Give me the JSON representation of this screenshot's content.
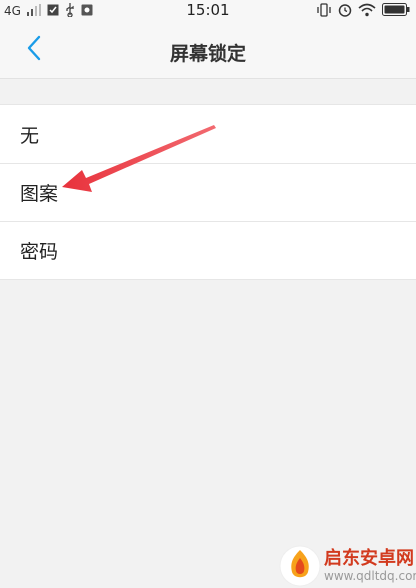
{
  "status_bar": {
    "network": "4G",
    "time": "15:01"
  },
  "header": {
    "title": "屏幕锁定"
  },
  "lock_options": [
    {
      "label": "无"
    },
    {
      "label": "图案"
    },
    {
      "label": "密码"
    }
  ],
  "colors": {
    "accent": "#1a9ce8",
    "arrow": "#e8323c"
  },
  "watermark": {
    "brand": "启东安卓网",
    "url": "www.qdltdq.com"
  }
}
